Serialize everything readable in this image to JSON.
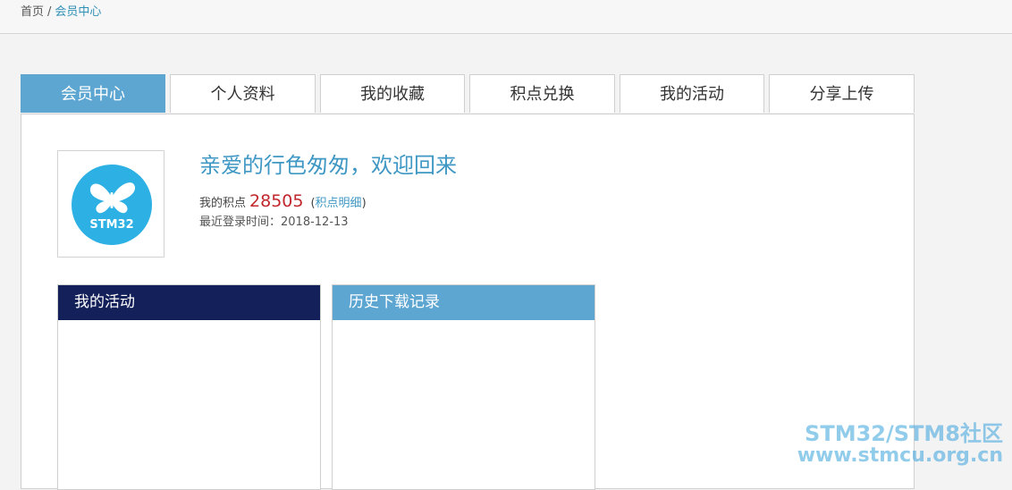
{
  "breadcrumb": {
    "home": "首页",
    "separator": "/",
    "current": "会员中心"
  },
  "tabs": [
    {
      "label": "会员中心",
      "active": true
    },
    {
      "label": "个人资料",
      "active": false
    },
    {
      "label": "我的收藏",
      "active": false
    },
    {
      "label": "积点兑换",
      "active": false
    },
    {
      "label": "我的活动",
      "active": false
    },
    {
      "label": "分享上传",
      "active": false
    }
  ],
  "profile": {
    "avatar_text": "STM32",
    "welcome": "亲爱的行色匆匆，欢迎回来",
    "points_label": "我的积点",
    "points_value": "28505",
    "paren_open": "(",
    "points_detail_link": "积点明细",
    "paren_close": ")",
    "last_login": "最近登录时间：2018-12-13"
  },
  "boxes": {
    "activity_title": "我的活动",
    "history_title": "历史下载记录"
  },
  "watermark": {
    "line1": "STM32/STM8社区",
    "line2": "www.stmcu.org.cn"
  },
  "colors": {
    "accent": "#5ea6d2",
    "dark_navy": "#132059",
    "points_red": "#c1272d",
    "link_blue": "#3f97c4"
  }
}
